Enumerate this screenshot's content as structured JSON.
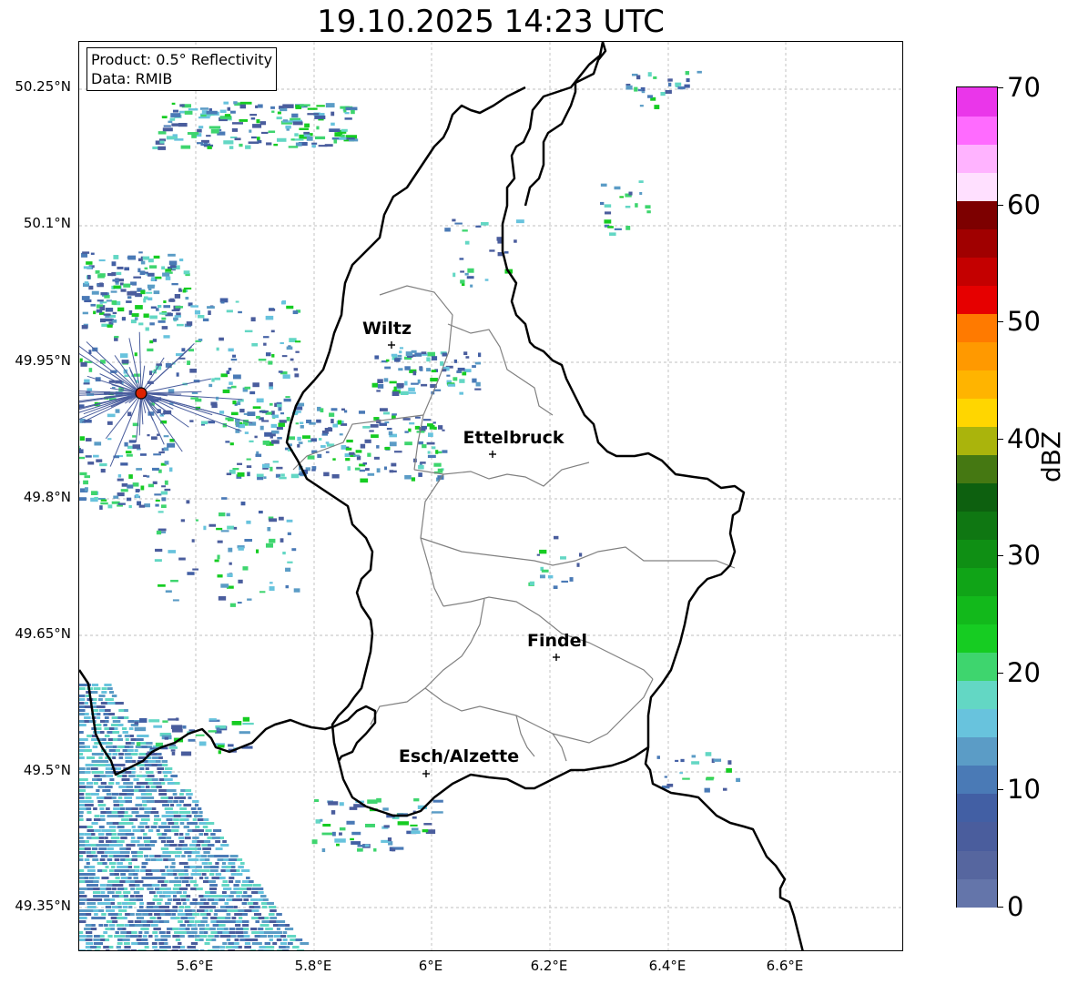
{
  "title": "19.10.2025 14:23 UTC",
  "info_box": {
    "product": "Product: 0.5° Reflectivity",
    "data_source": "Data: RMIB"
  },
  "axes": {
    "y_labels": [
      "50.25°N",
      "50.1°N",
      "49.95°N",
      "49.8°N",
      "49.65°N",
      "49.5°N",
      "49.35°N"
    ],
    "x_labels": [
      "5.6°E",
      "5.8°E",
      "6°E",
      "6.2°E",
      "6.4°E",
      "6.6°E"
    ]
  },
  "cities": [
    {
      "name": "Wiltz"
    },
    {
      "name": "Ettelbruck"
    },
    {
      "name": "Findel"
    },
    {
      "name": "Esch/Alzette"
    }
  ],
  "radar_marker": {
    "color": "#dd2200",
    "description": "radar site"
  },
  "colorbar": {
    "label": "dBZ",
    "ticks": [
      "0",
      "10",
      "20",
      "30",
      "40",
      "50",
      "60",
      "70"
    ],
    "colors": [
      "#6475aa",
      "#56669f",
      "#4a5d9d",
      "#425fa4",
      "#4a7ab6",
      "#5b9cc6",
      "#68c3dd",
      "#63d7c4",
      "#3ed56e",
      "#16cc22",
      "#12b91b",
      "#10a417",
      "#0f8f14",
      "#0f7712",
      "#0d600f",
      "#457812",
      "#aab40c",
      "#ffd600",
      "#ffb400",
      "#ff9900",
      "#ff7a00",
      "#e60000",
      "#c40000",
      "#a00000",
      "#7d0000",
      "#ffe0ff",
      "#ffb3ff",
      "#ff6bff",
      "#ea36ea"
    ]
  }
}
